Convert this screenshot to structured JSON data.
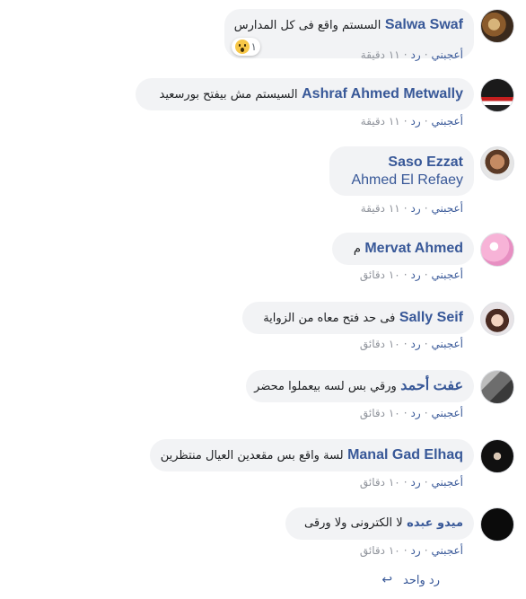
{
  "actions": {
    "like": "أعجبني",
    "reply": "رد",
    "sep": "·"
  },
  "comments": [
    {
      "author": "Salwa Swaf",
      "text": "السستم واقع فى كل المدارس",
      "time": "١١ دقيقة",
      "reaction_count": "١"
    },
    {
      "author": "Ashraf Ahmed Metwally",
      "text": "السيستم مش بيفتح بورسعيد",
      "time": "١١ دقيقة"
    },
    {
      "author": "Saso Ezzat",
      "tagged": "Ahmed El Refaey",
      "time": "١١ دقيقة"
    },
    {
      "author": "Mervat Ahmed",
      "text": "م",
      "time": "١٠ دقائق"
    },
    {
      "author": "Sally Seif",
      "text": "فى حد فتح معاه من الزواية",
      "time": "١٠ دقائق"
    },
    {
      "author": "عفت أحمد",
      "text": "ورقي بس لسه بيعملوا محضر",
      "time": "١٠ دقائق"
    },
    {
      "author": "Manal Gad Elhaq",
      "text": "لسة واقع بس مقعدين العيال منتظرين",
      "time": "١٠ دقائق"
    },
    {
      "author": "ميدو عبده",
      "text": "لا الكترونى ولا ورقى",
      "time": "١٠ دقائق"
    }
  ],
  "footer": {
    "reply_label": "رد واحد",
    "reply_icon": "reply-arrow-icon"
  },
  "colors": {
    "link": "#385898",
    "bubble": "#f2f3f5",
    "meta": "#90949c"
  }
}
